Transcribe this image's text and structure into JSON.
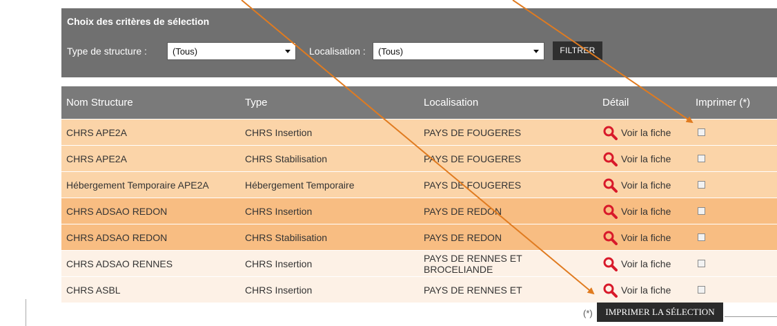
{
  "filter": {
    "title": "Choix des critères de sélection",
    "type_label": "Type de structure :",
    "type_value": "(Tous)",
    "loc_label": "Localisation :",
    "loc_value": "(Tous)",
    "button": "FILTRER"
  },
  "table": {
    "headers": [
      "Nom Structure",
      "Type",
      "Localisation",
      "Détail",
      "Imprimer (*)"
    ],
    "link_text": "Voir la fiche",
    "rows": [
      {
        "name": "CHRS APE2A",
        "type": "CHRS Insertion",
        "loc": "PAYS DE FOUGERES",
        "loc2": ""
      },
      {
        "name": "CHRS APE2A",
        "type": "CHRS Stabilisation",
        "loc": "PAYS DE FOUGERES",
        "loc2": ""
      },
      {
        "name": "Hébergement Temporaire APE2A",
        "type": "Hébergement Temporaire",
        "loc": "PAYS DE FOUGERES",
        "loc2": ""
      },
      {
        "name": "CHRS ADSAO REDON",
        "type": "CHRS Insertion",
        "loc": "PAYS DE REDON",
        "loc2": ""
      },
      {
        "name": "CHRS ADSAO REDON",
        "type": "CHRS Stabilisation",
        "loc": "PAYS DE REDON",
        "loc2": ""
      },
      {
        "name": "CHRS ADSAO RENNES",
        "type": "CHRS Insertion",
        "loc": "PAYS DE RENNES ET",
        "loc2": "BROCELIANDE"
      },
      {
        "name": "CHRS ASBL",
        "type": "CHRS Insertion",
        "loc": "PAYS DE RENNES ET",
        "loc2": ""
      }
    ]
  },
  "footer": {
    "note": "(*)",
    "print_button": "IMPRIMER LA SÉLECTION"
  },
  "colors": {
    "row_light": "#fbd4a8",
    "row_dark": "#f8bd82",
    "row_pale": "#fdf1e6",
    "annotation_arrow": "#e07b20",
    "search_icon": "#d8192a"
  },
  "icons": [
    "search-icon",
    "dropdown-arrow-icon",
    "checkbox"
  ]
}
